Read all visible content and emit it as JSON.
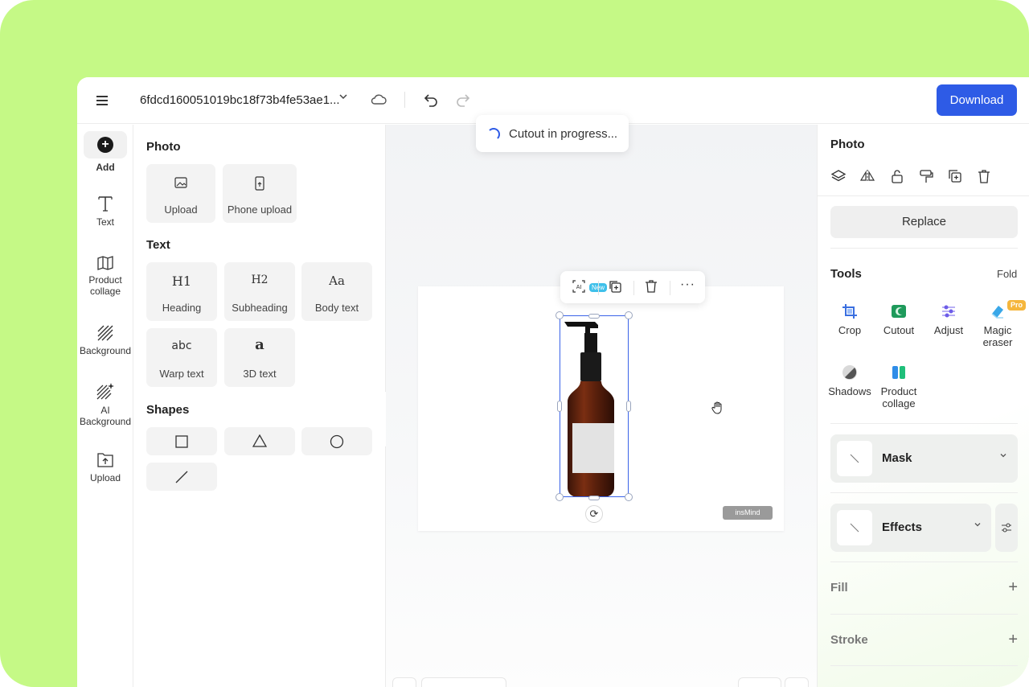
{
  "header": {
    "file_name": "6fdcd160051019bc18f73b4fe53ae1...",
    "download_label": "Download"
  },
  "toast": {
    "text": "Cutout in progress..."
  },
  "rail": {
    "items": [
      {
        "label": "Add",
        "icon": "add-icon"
      },
      {
        "label": "Text",
        "icon": "text-icon"
      },
      {
        "label": "Product collage",
        "icon": "collage-icon"
      },
      {
        "label": "Background",
        "icon": "background-icon"
      },
      {
        "label": "AI Background",
        "icon": "ai-background-icon"
      },
      {
        "label": "Upload",
        "icon": "upload-icon"
      }
    ]
  },
  "panel": {
    "photo_title": "Photo",
    "photo_tiles": [
      "Upload",
      "Phone upload"
    ],
    "text_title": "Text",
    "text_tiles": [
      {
        "label": "Heading",
        "glyph": "H1"
      },
      {
        "label": "Subheading",
        "glyph": "H2"
      },
      {
        "label": "Body text",
        "glyph": "Aa"
      },
      {
        "label": "Warp text",
        "glyph": "abc"
      },
      {
        "label": "3D text",
        "glyph": "a"
      }
    ],
    "shapes_title": "Shapes"
  },
  "canvas": {
    "watermark": "insMind",
    "new_badge": "New",
    "ai_label": "AI"
  },
  "right": {
    "title": "Photo",
    "replace_label": "Replace",
    "tools_title": "Tools",
    "fold_label": "Fold",
    "tools": [
      {
        "label": "Crop",
        "icon": "crop-icon",
        "color": "#3a6fe0"
      },
      {
        "label": "Cutout",
        "icon": "cutout-icon",
        "color": "#1e9a5b"
      },
      {
        "label": "Adjust",
        "icon": "adjust-icon",
        "color": "#6d5ce8"
      },
      {
        "label": "Magic eraser",
        "icon": "magic-eraser-icon",
        "color": "#39a7e8",
        "badge": "Pro"
      },
      {
        "label": "Shadows",
        "icon": "shadows-icon",
        "color": "#555555"
      },
      {
        "label": "Product collage",
        "icon": "product-collage-icon",
        "color": "#2f8de8"
      }
    ],
    "mask_label": "Mask",
    "effects_label": "Effects",
    "fill_label": "Fill",
    "stroke_label": "Stroke"
  },
  "colors": {
    "accent": "#2e5be6",
    "frame": "#c5f986",
    "selection": "#3a63e8"
  }
}
